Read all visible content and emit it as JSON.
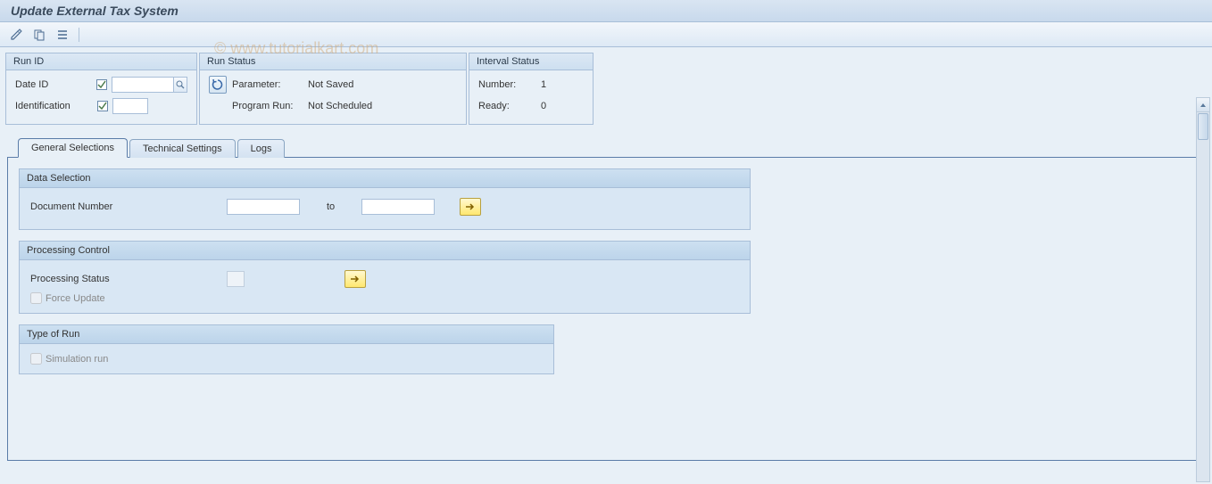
{
  "title": "Update External Tax System",
  "watermark": "© www.tutorialkart.com",
  "toolbar": {
    "icons": [
      "edit-tool-icon",
      "copy-tool-icon",
      "list-tool-icon"
    ]
  },
  "panels": {
    "run_id": {
      "title": "Run ID",
      "date_id_label": "Date ID",
      "identification_label": "Identification"
    },
    "run_status": {
      "title": "Run Status",
      "parameter_label": "Parameter:",
      "parameter_value": "Not Saved",
      "program_run_label": "Program Run:",
      "program_run_value": "Not Scheduled"
    },
    "interval_status": {
      "title": "Interval Status",
      "number_label": "Number:",
      "number_value": "1",
      "ready_label": "Ready:",
      "ready_value": "0"
    }
  },
  "tabs": [
    {
      "label": "General Selections",
      "active": true
    },
    {
      "label": "Technical Settings",
      "active": false
    },
    {
      "label": "Logs",
      "active": false
    }
  ],
  "groups": {
    "data_selection": {
      "title": "Data Selection",
      "doc_num_label": "Document Number",
      "to_label": "to"
    },
    "processing_control": {
      "title": "Processing Control",
      "proc_status_label": "Processing Status",
      "force_update_label": "Force Update"
    },
    "type_of_run": {
      "title": "Type of Run",
      "simulation_label": "Simulation run"
    }
  }
}
